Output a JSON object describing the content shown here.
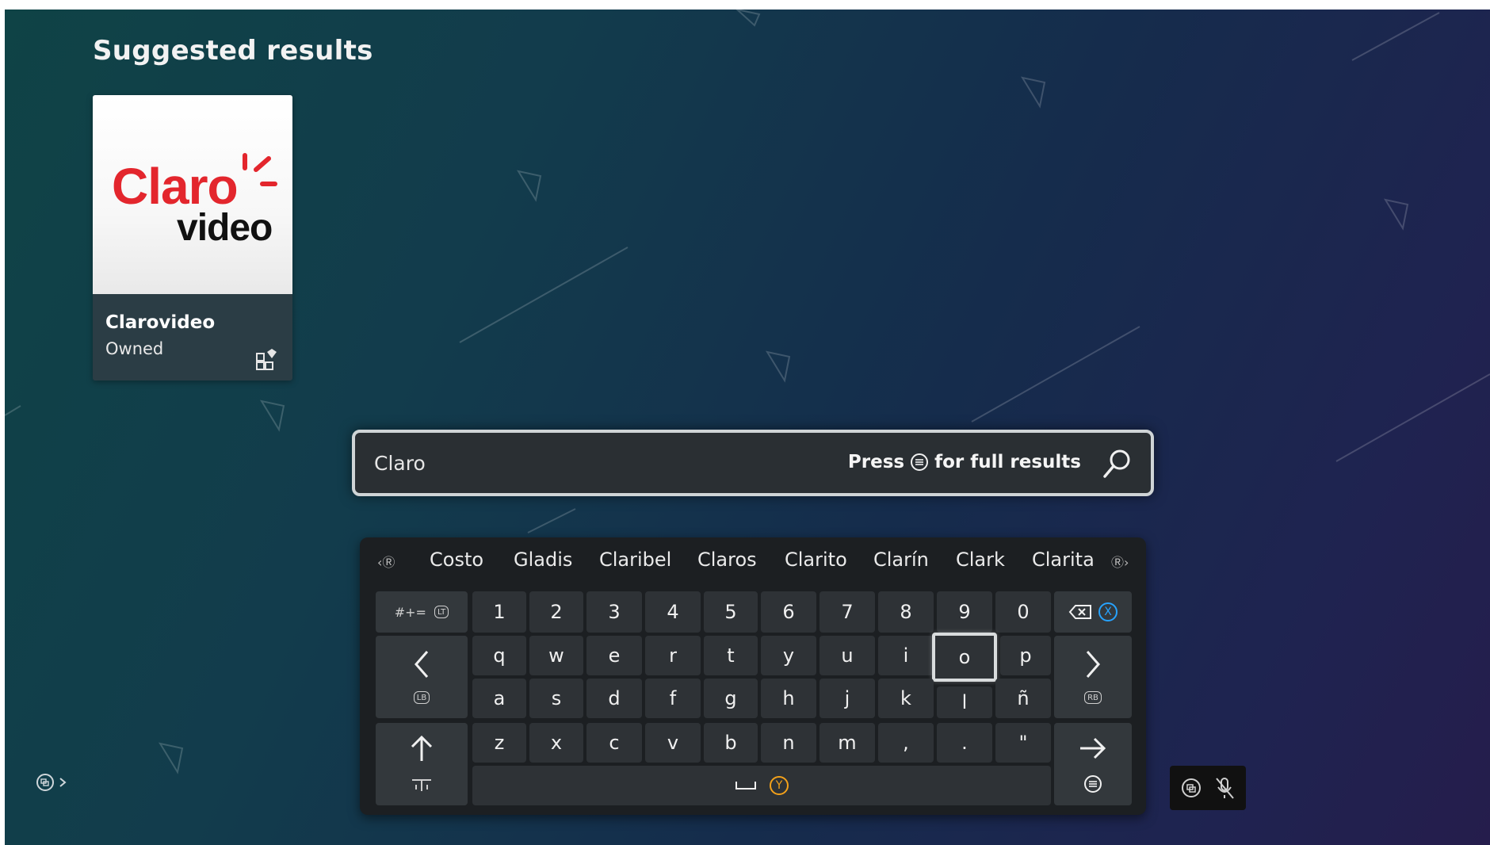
{
  "page": {
    "title": "Suggested results"
  },
  "result": {
    "name": "Clarovideo",
    "status": "Owned",
    "logo_top": "Claro",
    "logo_bottom": "video",
    "brand_color": "#e3262d"
  },
  "search": {
    "value": "Claro",
    "hint_prefix": "Press",
    "hint_suffix": "for full results"
  },
  "suggestions": [
    "Costo",
    "Gladis",
    "Claribel",
    "Claros",
    "Clarito",
    "Clarín",
    "Clark",
    "Clarita"
  ],
  "keyboard": {
    "symbols_label": "#+=",
    "numbers": [
      "1",
      "2",
      "3",
      "4",
      "5",
      "6",
      "7",
      "8",
      "9",
      "0"
    ],
    "row1": [
      "q",
      "w",
      "e",
      "r",
      "t",
      "y",
      "u",
      "i",
      "o",
      "p"
    ],
    "row2": [
      "a",
      "s",
      "d",
      "f",
      "g",
      "h",
      "j",
      "k",
      "l",
      "ñ"
    ],
    "row3": [
      "z",
      "x",
      "c",
      "v",
      "b",
      "n",
      "m",
      ",",
      ".",
      "\""
    ],
    "focused_key": "o",
    "lb_label": "LB",
    "rb_label": "RB",
    "lt_label": "LT",
    "x_label": "X",
    "y_label": "Y"
  },
  "accent_colors": {
    "x_button": "#27a3ff",
    "y_button": "#f3a11a"
  }
}
